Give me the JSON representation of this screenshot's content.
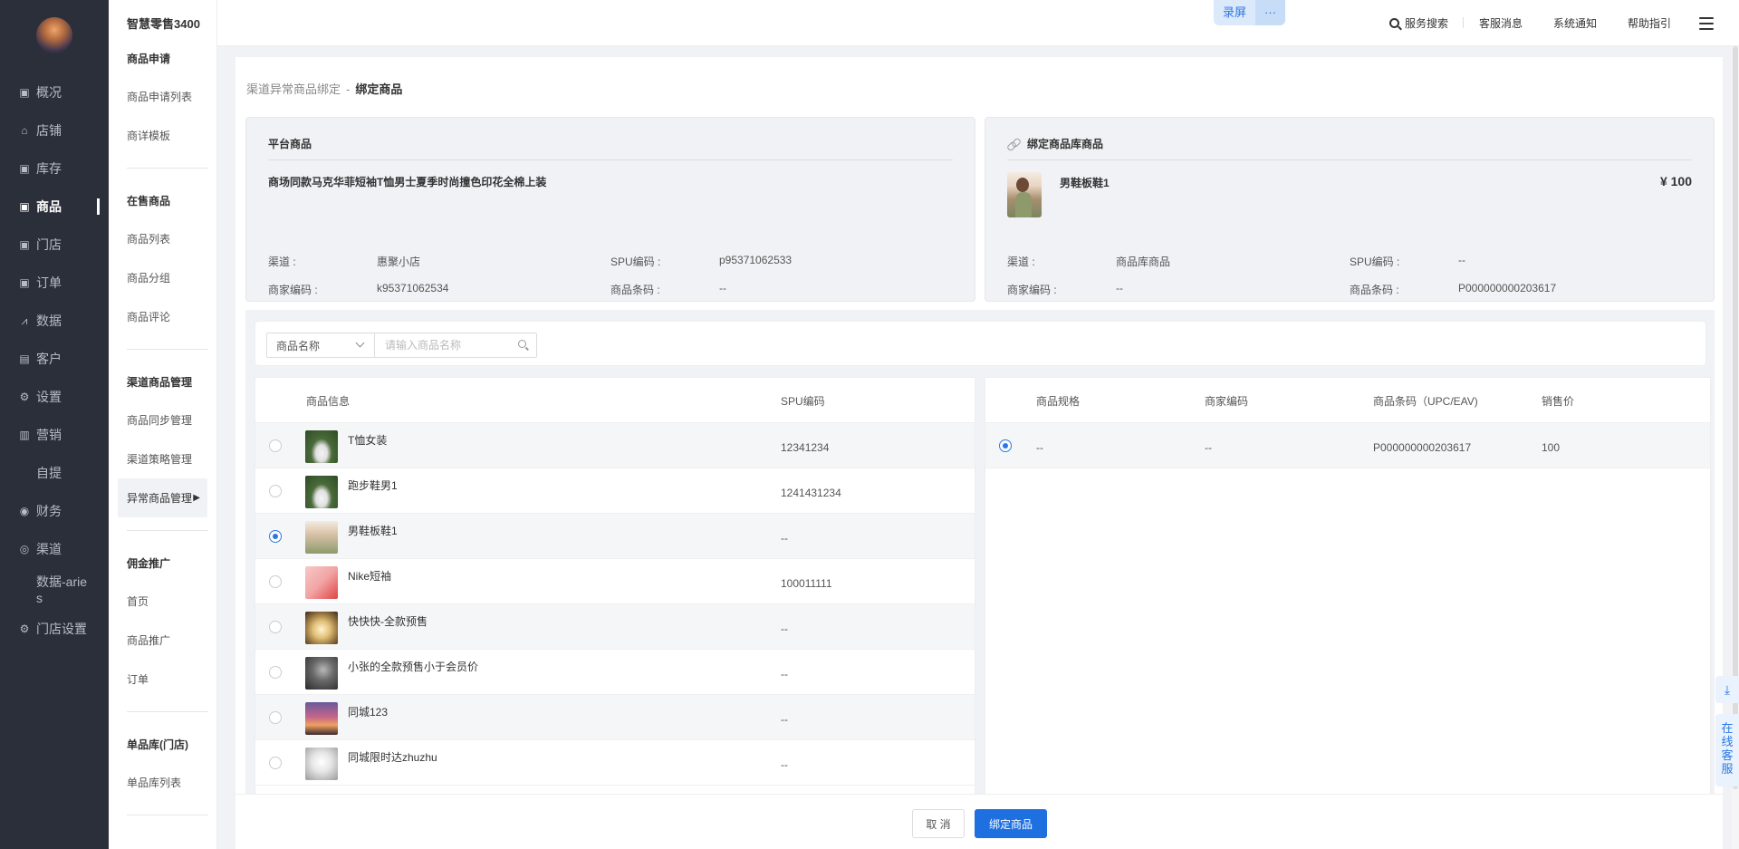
{
  "header": {
    "brand": "智慧零售3400",
    "record": "录屏",
    "record_more": "···",
    "links": [
      "服务搜索",
      "客服消息",
      "系统通知",
      "帮助指引"
    ]
  },
  "nav": {
    "items": [
      "概况",
      "店铺",
      "库存",
      "商品",
      "门店",
      "订单",
      "数据",
      "客户",
      "设置",
      "营销",
      "自提",
      "财务",
      "渠道",
      "数据-aries",
      "门店设置"
    ],
    "icons": [
      "bag-icon",
      "store-icon",
      "bag-icon",
      "bag-icon",
      "bag-icon",
      "bag-icon",
      "chart-icon",
      "card-icon",
      "gear-icon",
      "bar-icon",
      "",
      "coin-icon",
      "chat-icon",
      "",
      "gear-icon"
    ]
  },
  "subnav": {
    "groups": [
      {
        "title": "商品申请",
        "items": [
          "商品申请列表",
          "商详模板"
        ]
      },
      {
        "title": "在售商品",
        "items": [
          "商品列表",
          "商品分组",
          "商品评论"
        ]
      },
      {
        "title": "渠道商品管理",
        "items": [
          "商品同步管理",
          "渠道策略管理",
          "异常商品管理"
        ]
      },
      {
        "title": "佣金推广",
        "items": [
          "首页",
          "商品推广",
          "订单"
        ]
      },
      {
        "title": "单品库(门店)",
        "items": [
          "单品库列表"
        ]
      }
    ]
  },
  "breadcrumb": {
    "parent": "渠道异常商品绑定",
    "sep": "-",
    "current": "绑定商品"
  },
  "platform_card": {
    "title": "平台商品",
    "product_name": "商场同款马克华菲短袖T恤男士夏季时尚撞色印花全棉上装",
    "fields": [
      {
        "k": "渠道 :",
        "v": "惠聚小店"
      },
      {
        "k": "SPU编码 :",
        "v": "p95371062533"
      },
      {
        "k": "商家编码 :",
        "v": "k95371062534"
      },
      {
        "k": "商品条码 :",
        "v": "--"
      }
    ]
  },
  "bound_card": {
    "title": "绑定商品库商品",
    "product_name": "男鞋板鞋1",
    "price": "¥ 100",
    "fields": [
      {
        "k": "渠道 :",
        "v": "商品库商品"
      },
      {
        "k": "SPU编码 :",
        "v": "--"
      },
      {
        "k": "商家编码 :",
        "v": "--"
      },
      {
        "k": "商品条码 :",
        "v": "P000000000203617"
      }
    ]
  },
  "filter": {
    "select": "商品名称",
    "placeholder": "请输入商品名称"
  },
  "left_table": {
    "headers": [
      "商品信息",
      "SPU编码"
    ],
    "rows": [
      {
        "name": "T恤女装",
        "spu": "12341234"
      },
      {
        "name": "跑步鞋男1",
        "spu": "1241431234"
      },
      {
        "name": "男鞋板鞋1",
        "spu": "--"
      },
      {
        "name": "Nike短袖",
        "spu": "100011111"
      },
      {
        "name": "快快快-全款预售",
        "spu": "--"
      },
      {
        "name": "小张的全款预售小于会员价",
        "spu": "--"
      },
      {
        "name": "同城123",
        "spu": "--"
      },
      {
        "name": "同城限时达zhuzhu",
        "spu": "--"
      }
    ]
  },
  "right_table": {
    "headers": [
      "商品规格",
      "商家编码",
      "商品条码（UPC/EAV)",
      "销售价"
    ],
    "rows": [
      {
        "spec": "--",
        "code": "--",
        "barcode": "P000000000203617",
        "price": "100"
      }
    ]
  },
  "buttons": {
    "cancel": "取 消",
    "confirm": "绑定商品"
  },
  "float": {
    "service": "在线客服"
  },
  "colors": {
    "primary": "#1e6fe0",
    "nav_bg": "#2b2f3a"
  }
}
